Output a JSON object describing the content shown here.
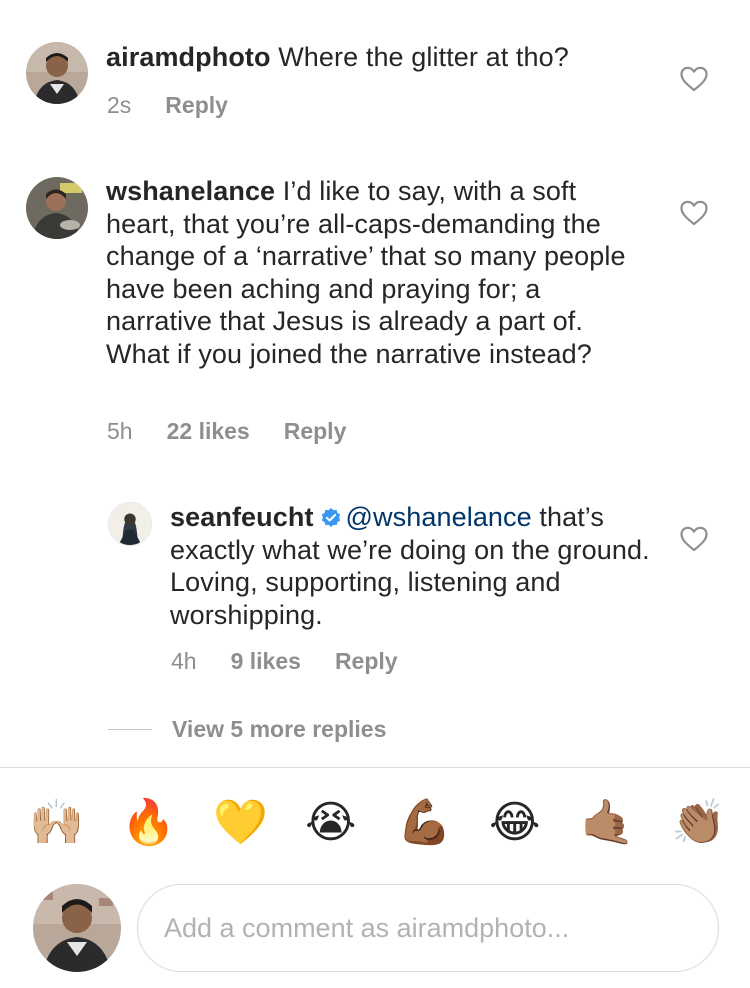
{
  "comments": [
    {
      "username": "airamdphoto",
      "text": "Where the glitter at tho?",
      "time": "2s",
      "reply_label": "Reply",
      "avatar_icon": "profile-photo"
    },
    {
      "username": "wshanelance",
      "text": "I’d like to say, with a soft heart, that you’re all-caps-demanding the change of a ‘narrative’ that so many people have been aching and praying for; a narrative that Jesus is already a part of. What if you joined the narrative instead?",
      "time": "5h",
      "likes": "22 likes",
      "reply_label": "Reply",
      "avatar_icon": "profile-photo"
    }
  ],
  "reply": {
    "username": "seanfeucht",
    "verified_icon": "verified-badge-icon",
    "mention": "@wshanelance",
    "text": "that’s exactly what we’re doing on the ground. Loving, supporting, listening and worshipping.",
    "time": "4h",
    "likes": "9 likes",
    "reply_label": "Reply"
  },
  "view_more_replies": "View 5 more replies",
  "emoji_bar": [
    "🙌🏼",
    "🔥",
    "💛",
    "😭",
    "💪🏾",
    "😂",
    "🤙🏽",
    "👏🏽"
  ],
  "composer": {
    "placeholder": "Add a comment as airamdphoto..."
  },
  "colors": {
    "text": "#262626",
    "meta": "#8e8e8e",
    "mention": "#003569",
    "verified": "#3897f0",
    "border": "#dbdbdb"
  }
}
